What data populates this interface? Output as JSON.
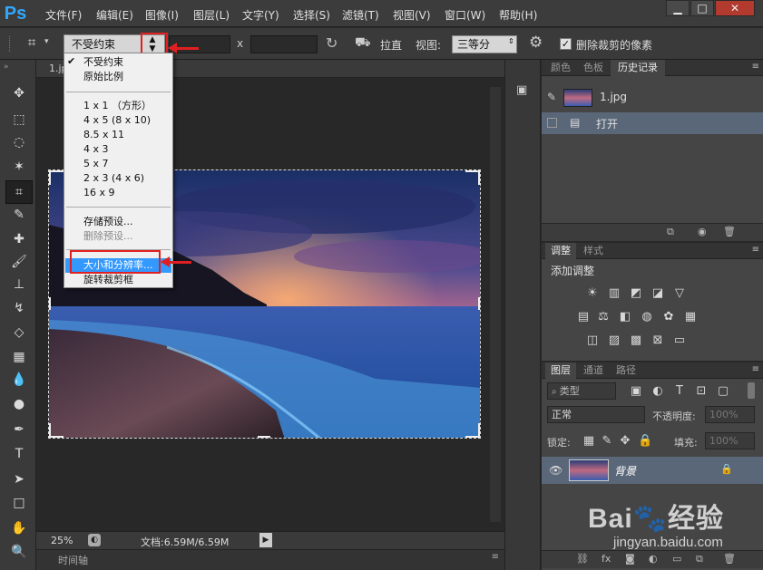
{
  "app": {
    "logo": "Ps"
  },
  "menu": [
    "文件(F)",
    "编辑(E)",
    "图像(I)",
    "图层(L)",
    "文字(Y)",
    "选择(S)",
    "滤镜(T)",
    "视图(V)",
    "窗口(W)",
    "帮助(H)"
  ],
  "window_buttons": {
    "minimize": "▁",
    "maximize": "□",
    "close": "✕"
  },
  "options": {
    "ratio_selected": "不受约束",
    "x_label": "x",
    "straighten": "拉直",
    "view_label": "视图:",
    "view_value": "三等分",
    "delete_cropped": "删除裁剪的像素"
  },
  "dropdown": {
    "group1": [
      "不受约束",
      "原始比例"
    ],
    "group2": [
      "1 x 1 （方形）",
      "4 x 5 (8 x 10)",
      "8.5 x 11",
      "4 x 3",
      "5 x 7",
      "2 x 3 (4 x 6)",
      "16 x 9"
    ],
    "group3": [
      "存储预设...",
      "删除预设..."
    ],
    "group4": [
      "大小和分辨率...",
      "旋转裁剪框"
    ]
  },
  "document": {
    "tab": "1.jpg",
    "zoom": "25%",
    "doc_info": "文档:6.59M/6.59M",
    "timeline": "时间轴"
  },
  "history_panel": {
    "tabs": [
      "颜色",
      "色板",
      "历史记录"
    ],
    "snapshot_name": "1.jpg",
    "steps": [
      "打开"
    ]
  },
  "adjust_panel": {
    "tabs": [
      "调整",
      "样式"
    ],
    "title": "添加调整"
  },
  "layers_panel": {
    "tabs": [
      "图层",
      "通道",
      "路径"
    ],
    "filter_kind": "类型",
    "blend_mode": "正常",
    "opacity_label": "不透明度:",
    "opacity_value": "100%",
    "lock_label": "锁定:",
    "fill_label": "填充:",
    "fill_value": "100%",
    "layer_name": "背景"
  },
  "watermark": {
    "logo": "Bai🐾经验",
    "url": "jingyan.baidu.com"
  },
  "colors": {
    "accent": "#e02020",
    "selection": "#3399ff",
    "layer_selected": "#5a6778"
  }
}
